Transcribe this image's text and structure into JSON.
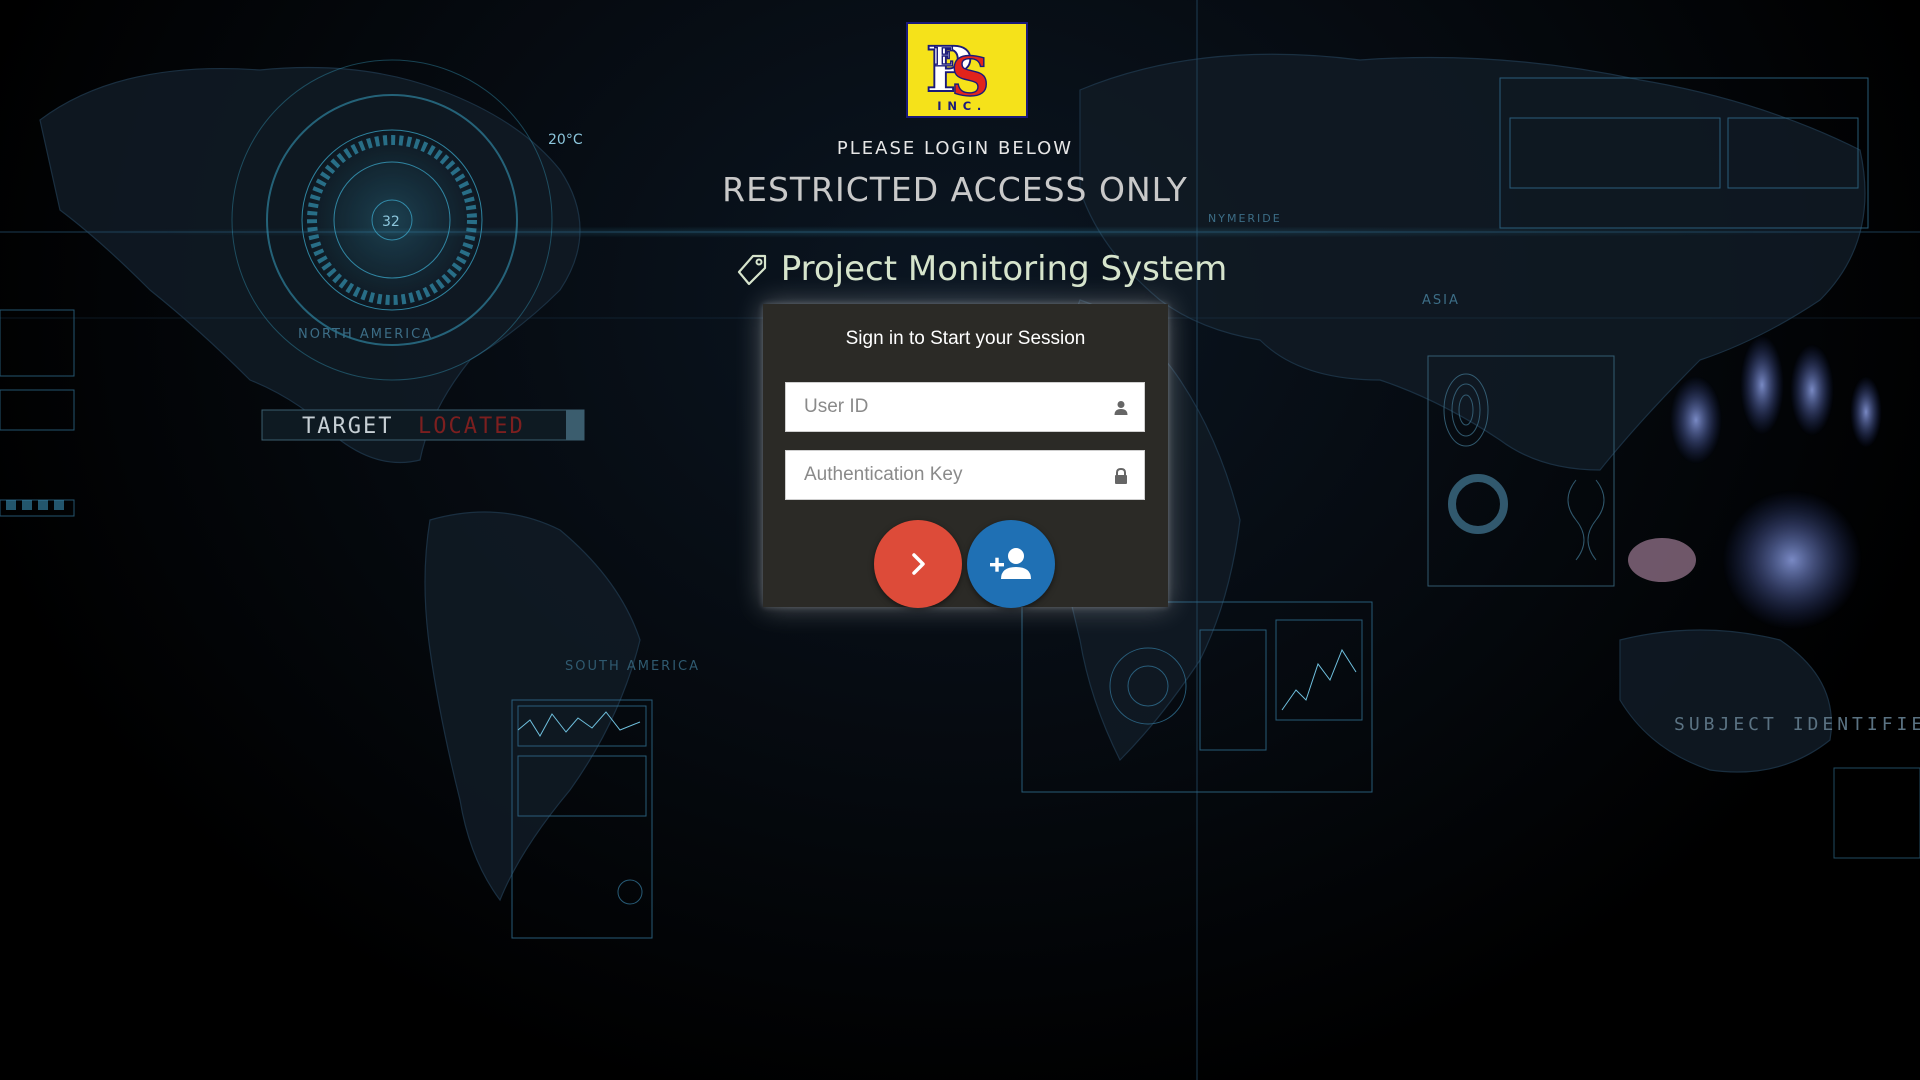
{
  "header": {
    "logo_name": "company-logo",
    "login_prompt": "PLEASE LOGIN BELOW",
    "restriction_notice": "RESTRICTED ACCESS ONLY",
    "app_title": "Project Monitoring System",
    "title_icon": "tag-icon"
  },
  "login_panel": {
    "title": "Sign in to Start your Session",
    "user_id": {
      "placeholder": "User ID",
      "value": "",
      "icon": "user-icon"
    },
    "auth_key": {
      "placeholder": "Authentication Key",
      "value": "",
      "icon": "lock-icon"
    },
    "signin_button": {
      "icon": "chevron-right-icon",
      "color": "#dd4b39"
    },
    "register_button": {
      "icon": "add-user-icon",
      "color": "#1f70b4"
    }
  },
  "background": {
    "theme": "dark world map with holographic hud panels",
    "overlay_texts": [
      "TARGET",
      "LOCATED",
      "SUBJECT IDENTIFIED",
      "NORTH AMERICA",
      "SOUTH AMERICA",
      "ASIA",
      "20°C",
      "32",
      "NYMERIDE"
    ]
  }
}
